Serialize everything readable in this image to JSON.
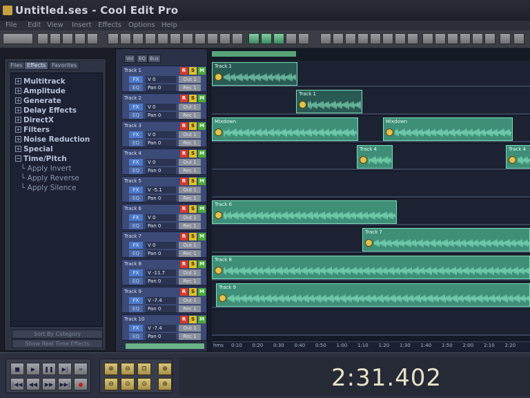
{
  "window": {
    "title": "Untitled.ses - Cool Edit Pro"
  },
  "menu": [
    "File",
    "Edit",
    "View",
    "Insert",
    "Effects",
    "Options",
    "Help"
  ],
  "organizer": {
    "tabs": [
      "Files",
      "Effects",
      "Favorites"
    ],
    "active_tab": "Effects",
    "tree": [
      {
        "label": "Multitrack",
        "kind": "group"
      },
      {
        "label": "Amplitude",
        "kind": "group"
      },
      {
        "label": "Generate",
        "kind": "group"
      },
      {
        "label": "Delay Effects",
        "kind": "group"
      },
      {
        "label": "DirectX",
        "kind": "group"
      },
      {
        "label": "Filters",
        "kind": "group"
      },
      {
        "label": "Noise Reduction",
        "kind": "group"
      },
      {
        "label": "Special",
        "kind": "group"
      },
      {
        "label": "Time/Pitch",
        "kind": "group"
      },
      {
        "label": "Apply Invert",
        "kind": "item"
      },
      {
        "label": "Apply Reverse",
        "kind": "item"
      },
      {
        "label": "Apply Silence",
        "kind": "item"
      }
    ],
    "buttons": [
      "Sort By Category",
      "Show Real Time Effects"
    ]
  },
  "track_panel": {
    "view_tabs": [
      "Vol",
      "EQ",
      "Bus"
    ],
    "buttons": {
      "rec": "R",
      "solo": "S",
      "mute": "M",
      "fx": "FX",
      "eq": "EQ",
      "out": "Out 1",
      "rec_in": "Rec 1"
    },
    "tracks": [
      {
        "name": "Track 1",
        "volume": "V 0",
        "pan": "Pan 0"
      },
      {
        "name": "Track 2",
        "volume": "V 0",
        "pan": "Pan 0"
      },
      {
        "name": "Track 3",
        "volume": "V 0",
        "pan": "Pan 0"
      },
      {
        "name": "Track 4",
        "volume": "V 0",
        "pan": "Pan 0"
      },
      {
        "name": "Track 5",
        "volume": "V -5.1",
        "pan": "Pan 0"
      },
      {
        "name": "Track 6",
        "volume": "V 0",
        "pan": "Pan 0"
      },
      {
        "name": "Track 7",
        "volume": "V 0",
        "pan": "Pan 0"
      },
      {
        "name": "Track 8",
        "volume": "V -11.7",
        "pan": "Pan 0"
      },
      {
        "name": "Track 9",
        "volume": "V -7.4",
        "pan": "Pan 0"
      },
      {
        "name": "Track 10",
        "volume": "V -7.4",
        "pan": "Pan 0"
      }
    ]
  },
  "clips": [
    {
      "label": "Track 1"
    },
    {
      "label": "Track 1"
    },
    {
      "label": "Mixdown"
    },
    {
      "label": "Mixdown"
    },
    {
      "label": "Track 4"
    },
    {
      "label": "Track 4"
    },
    {
      "label": "Track 6"
    },
    {
      "label": "Track 7"
    },
    {
      "label": "Track 8"
    },
    {
      "label": "Track 9"
    }
  ],
  "ruler": {
    "unit": "hms",
    "ticks": [
      "0:10",
      "0:20",
      "0:30",
      "0:40",
      "0:50",
      "1:00",
      "1:10",
      "1:20",
      "1:30",
      "1:40",
      "1:50",
      "2:00",
      "2:10",
      "2:20"
    ]
  },
  "transport": {
    "buttons": [
      {
        "name": "stop",
        "glyph": "■"
      },
      {
        "name": "play",
        "glyph": "▶"
      },
      {
        "name": "pause",
        "glyph": "❚❚"
      },
      {
        "name": "play-to-end",
        "glyph": "▶|"
      },
      {
        "name": "loop",
        "glyph": "∞"
      },
      {
        "name": "go-to-start",
        "glyph": "|◀◀"
      },
      {
        "name": "rewind",
        "glyph": "◀◀"
      },
      {
        "name": "fast-forward",
        "glyph": "▶▶"
      },
      {
        "name": "go-to-end",
        "glyph": "▶▶|"
      },
      {
        "name": "record",
        "glyph": "●"
      }
    ],
    "zoom_buttons": [
      {
        "name": "zoom-in-horizontal",
        "glyph": "⊕"
      },
      {
        "name": "zoom-out-horizontal",
        "glyph": "⊖"
      },
      {
        "name": "zoom-full",
        "glyph": "⊡"
      },
      {
        "name": "zoom-in-vertical",
        "glyph": "⊕"
      },
      {
        "name": "zoom-out-vertical",
        "glyph": "⊖"
      },
      {
        "name": "zoom-to-left",
        "glyph": "⊙"
      },
      {
        "name": "zoom-to-right",
        "glyph": "⊙"
      },
      {
        "name": "zoom-selection",
        "glyph": "⊛"
      }
    ]
  },
  "time_display": "2:31.402",
  "colors": {
    "clip": "#3e8e78",
    "track_header": "#3c4a78",
    "rec": "#d83a2a",
    "solo": "#e0c020",
    "mute": "#4aaa3a",
    "lock": "#e6c24a"
  }
}
